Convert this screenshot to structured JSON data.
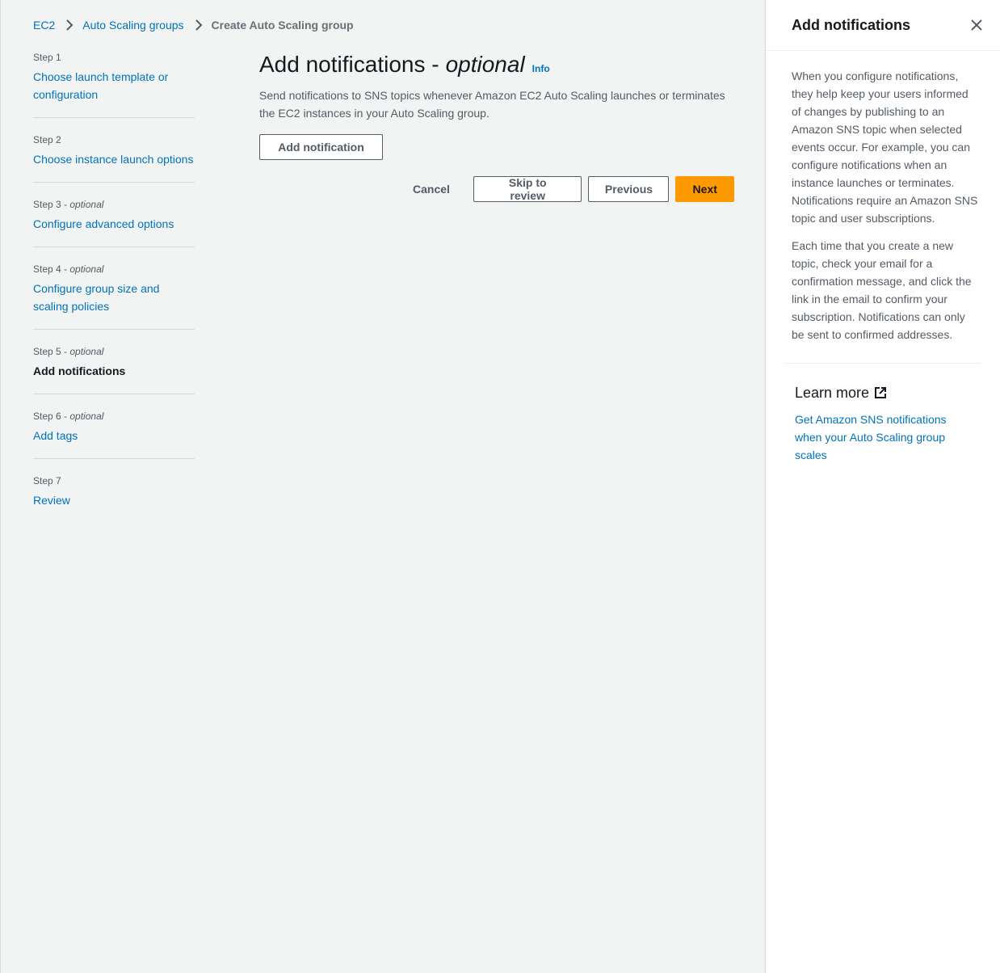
{
  "breadcrumb": {
    "items": [
      "EC2",
      "Auto Scaling groups"
    ],
    "current": "Create Auto Scaling group"
  },
  "steps": [
    {
      "num": "Step 1",
      "optional": "",
      "title": "Choose launch template or configuration",
      "active": false
    },
    {
      "num": "Step 2",
      "optional": "",
      "title": "Choose instance launch options",
      "active": false
    },
    {
      "num": "Step 3",
      "optional": "optional",
      "title": "Configure advanced options",
      "active": false
    },
    {
      "num": "Step 4",
      "optional": "optional",
      "title": "Configure group size and scaling policies",
      "active": false
    },
    {
      "num": "Step 5",
      "optional": "optional",
      "title": "Add notifications",
      "active": true
    },
    {
      "num": "Step 6",
      "optional": "optional",
      "title": "Add tags",
      "active": false
    },
    {
      "num": "Step 7",
      "optional": "",
      "title": "Review",
      "active": false
    }
  ],
  "main": {
    "title": "Add notifications -",
    "title_optional": "optional",
    "info": "Info",
    "description": "Send notifications to SNS topics whenever Amazon EC2 Auto Scaling launches or terminates the EC2 instances in your Auto Scaling group.",
    "add_button": "Add notification"
  },
  "actions": {
    "cancel": "Cancel",
    "skip": "Skip to review",
    "previous": "Previous",
    "next": "Next"
  },
  "help_panel": {
    "title": "Add notifications",
    "paragraphs": [
      "When you configure notifications, they help keep your users informed of changes by publishing to an Amazon SNS topic when selected events occur. For example, you can configure notifications when an instance launches or terminates. Notifications require an Amazon SNS topic and user subscriptions.",
      "Each time that you create a new topic, check your email for a confirmation message, and click the link in the email to confirm your subscription. Notifications can only be sent to confirmed addresses."
    ],
    "learn_more_title": "Learn more",
    "learn_more_link": "Get Amazon SNS notifications when your Auto Scaling group scales"
  },
  "colors": {
    "link": "#0073bb",
    "primary_button": "#ff9900",
    "background": "#f2f3f3"
  },
  "icons": [
    "chevron-right-icon",
    "close-icon",
    "external-link-icon"
  ]
}
